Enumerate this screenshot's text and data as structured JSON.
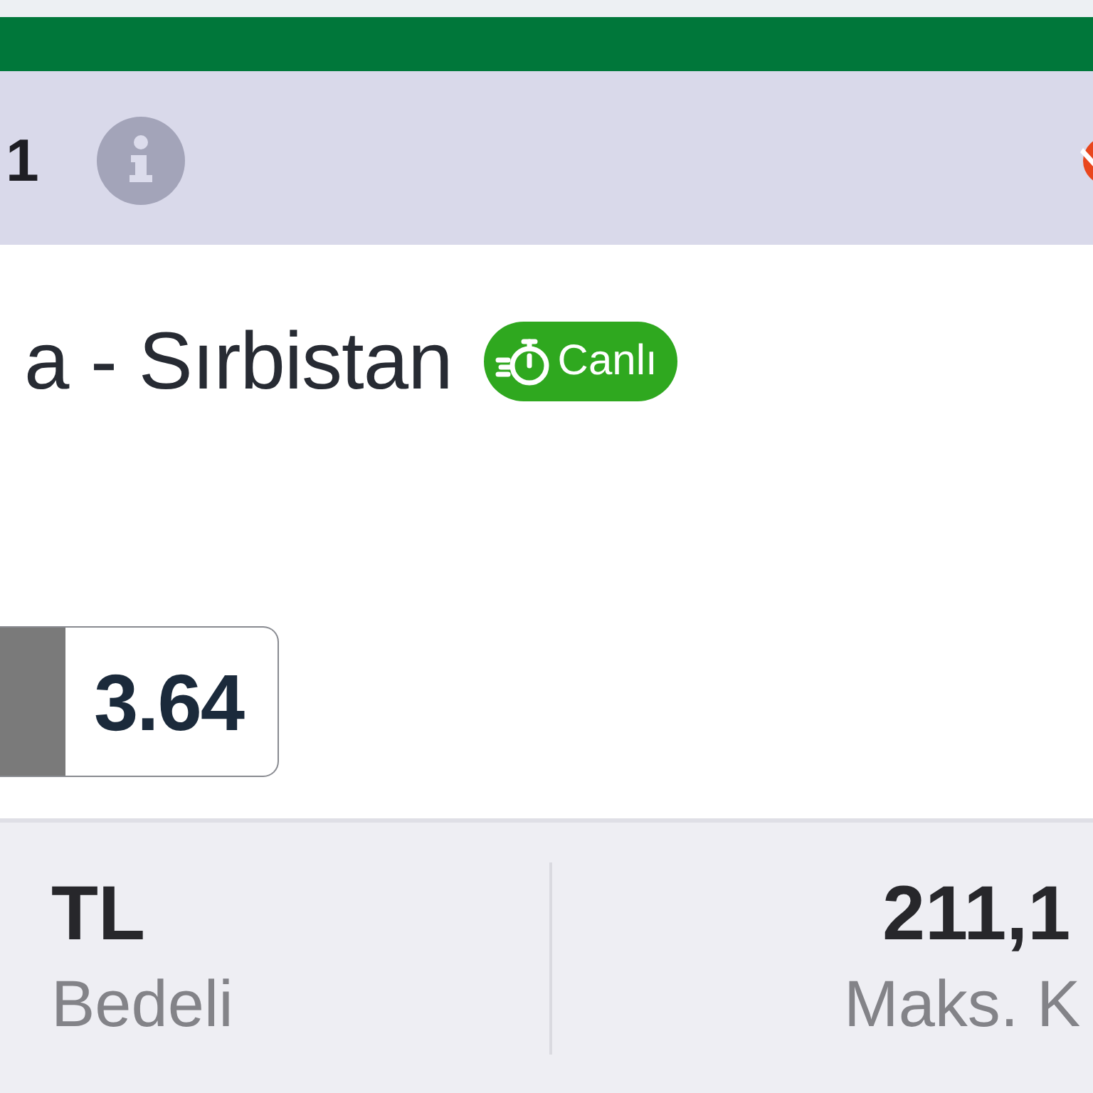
{
  "header": {
    "number": "1"
  },
  "event": {
    "title": "a - Sırbistan",
    "live_badge": "Canlı"
  },
  "odd": {
    "value": "3.64"
  },
  "summary": [
    {
      "value": "TL",
      "label": "Bedeli"
    },
    {
      "value": "211,1",
      "label": "Maks. K"
    }
  ]
}
